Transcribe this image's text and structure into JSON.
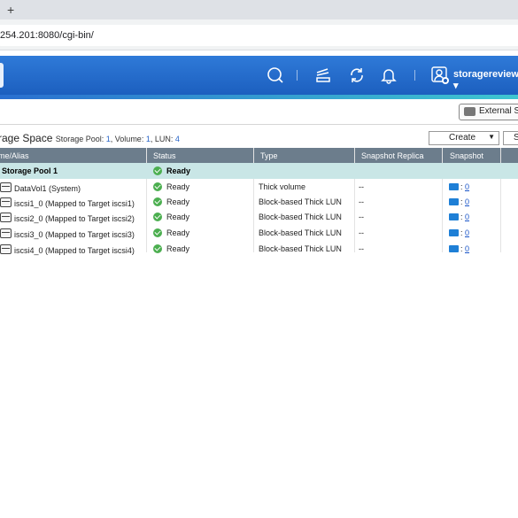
{
  "browser": {
    "new_tab": "+",
    "address": "254.201:8080/cgi-bin/"
  },
  "topbar": {
    "user_name": "storagereview ▾",
    "icons": [
      "search-icon",
      "task-icon",
      "sync-icon",
      "bell-icon",
      "user-icon"
    ]
  },
  "toolbar": {
    "external_label": "External Sto"
  },
  "header": {
    "title": "rage Space",
    "summary_prefix": "Storage Pool: ",
    "pool_count": "1",
    "volume_prefix": ", Volume: ",
    "volume_count": "1",
    "lun_prefix": ", LUN: ",
    "lun_count": "4",
    "create_label": "Create",
    "s_label": "S"
  },
  "table": {
    "columns": [
      "me/Alias",
      "Status",
      "Type",
      "Snapshot Replica",
      "Snapshot"
    ],
    "pool": {
      "name": "Storage Pool 1",
      "status": "Ready"
    },
    "rows": [
      {
        "name": "DataVol1 (System)",
        "status": "Ready",
        "type": "Thick volume",
        "replica": "--",
        "snapshot": "0"
      },
      {
        "name": "iscsi1_0 (Mapped to Target iscsi1)",
        "status": "Ready",
        "type": "Block-based Thick LUN",
        "replica": "--",
        "snapshot": "0"
      },
      {
        "name": "iscsi2_0 (Mapped to Target iscsi2)",
        "status": "Ready",
        "type": "Block-based Thick LUN",
        "replica": "--",
        "snapshot": "0"
      },
      {
        "name": "iscsi3_0 (Mapped to Target iscsi3)",
        "status": "Ready",
        "type": "Block-based Thick LUN",
        "replica": "--",
        "snapshot": "0"
      },
      {
        "name": "iscsi4_0 (Mapped to Target iscsi4)",
        "status": "Ready",
        "type": "Block-based Thick LUN",
        "replica": "--",
        "snapshot": "0"
      }
    ]
  },
  "colors": {
    "accent": "#2f7ad8",
    "ready": "#4caf50",
    "pool_bg": "#c9e6e6",
    "header_bg": "#6c7d8c"
  }
}
